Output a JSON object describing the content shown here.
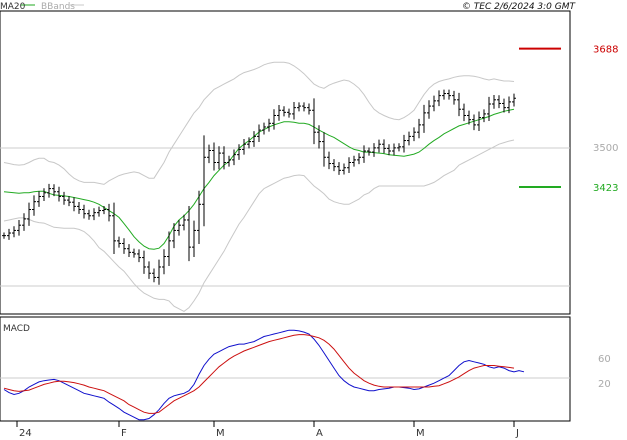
{
  "header": {
    "ma_label": "MA20",
    "bb_label": "BBands",
    "credit": "© TEC 2/6/2024 3:0 GMT"
  },
  "colors": {
    "ma": "#22aa22",
    "bbands": "#c8c8c8",
    "bars": "#000000",
    "macd_line": "#1010cc",
    "signal_line": "#cc1010",
    "resistance": "#cc0000",
    "support": "#22aa22",
    "grid": "#cccccc",
    "border": "#000000"
  },
  "chart_data": [
    {
      "type": "ohlc",
      "title": "",
      "price_axis": {
        "ticks": [
          {
            "value": 3500,
            "label": "3500"
          }
        ],
        "range": [
          3180,
          3760
        ]
      },
      "x_axis": {
        "month_labels": [
          {
            "index": 0,
            "label": "24"
          },
          {
            "index": 23,
            "label": "F"
          },
          {
            "index": 42,
            "label": "M"
          },
          {
            "index": 62,
            "label": "A"
          },
          {
            "index": 82,
            "label": "M"
          },
          {
            "index": 102,
            "label": "J"
          }
        ],
        "count": 103
      },
      "levels": [
        {
          "name": "resistance",
          "value": 3688,
          "label": "3688"
        },
        {
          "name": "support",
          "value": 3423,
          "label": "3423"
        }
      ],
      "closes": [
        3330,
        3335,
        3340,
        3350,
        3362,
        3380,
        3395,
        3405,
        3412,
        3420,
        3414,
        3405,
        3398,
        3394,
        3386,
        3380,
        3372,
        3368,
        3374,
        3378,
        3380,
        3368,
        3320,
        3315,
        3305,
        3298,
        3295,
        3288,
        3270,
        3258,
        3250,
        3270,
        3290,
        3320,
        3340,
        3350,
        3360,
        3308,
        3340,
        3390,
        3480,
        3493,
        3470,
        3488,
        3470,
        3475,
        3485,
        3495,
        3505,
        3510,
        3520,
        3532,
        3538,
        3545,
        3560,
        3570,
        3566,
        3563,
        3575,
        3578,
        3575,
        3570,
        3528,
        3510,
        3480,
        3468,
        3462,
        3455,
        3460,
        3470,
        3475,
        3480,
        3492,
        3490,
        3498,
        3505,
        3497,
        3492,
        3498,
        3500,
        3512,
        3520,
        3528,
        3542,
        3565,
        3578,
        3588,
        3598,
        3602,
        3598,
        3590,
        3572,
        3560,
        3552,
        3542,
        3556,
        3563,
        3582,
        3590,
        3583,
        3575,
        3586,
        3593
      ],
      "ma20": [
        3414,
        3413,
        3412,
        3411,
        3412,
        3412,
        3414,
        3415,
        3415,
        3411,
        3408,
        3407,
        3406,
        3405,
        3403,
        3401,
        3399,
        3397,
        3394,
        3390,
        3384,
        3378,
        3372,
        3365,
        3353,
        3341,
        3328,
        3318,
        3310,
        3305,
        3304,
        3306,
        3315,
        3330,
        3348,
        3360,
        3368,
        3378,
        3390,
        3405,
        3420,
        3432,
        3445,
        3455,
        3465,
        3472,
        3485,
        3497,
        3505,
        3512,
        3520,
        3528,
        3533,
        3538,
        3542,
        3545,
        3548,
        3548,
        3547,
        3545,
        3545,
        3543,
        3538,
        3532,
        3527,
        3522,
        3518,
        3512,
        3506,
        3500,
        3495,
        3493,
        3490,
        3490,
        3489,
        3488,
        3487,
        3485,
        3484,
        3483,
        3482,
        3484,
        3486,
        3490,
        3497,
        3505,
        3512,
        3518,
        3525,
        3530,
        3535,
        3540,
        3543,
        3546,
        3549,
        3552,
        3555,
        3558,
        3562,
        3565,
        3568,
        3570,
        3572
      ],
      "bb_upper": [
        3470,
        3468,
        3466,
        3465,
        3466,
        3470,
        3475,
        3478,
        3478,
        3472,
        3470,
        3465,
        3458,
        3448,
        3440,
        3435,
        3432,
        3432,
        3432,
        3430,
        3428,
        3435,
        3440,
        3445,
        3448,
        3450,
        3452,
        3450,
        3445,
        3440,
        3440,
        3455,
        3470,
        3490,
        3505,
        3520,
        3535,
        3550,
        3565,
        3575,
        3590,
        3600,
        3610,
        3615,
        3620,
        3625,
        3630,
        3637,
        3642,
        3645,
        3648,
        3652,
        3657,
        3660,
        3662,
        3662,
        3662,
        3660,
        3655,
        3648,
        3640,
        3630,
        3620,
        3615,
        3612,
        3618,
        3622,
        3625,
        3628,
        3626,
        3620,
        3612,
        3600,
        3585,
        3572,
        3565,
        3560,
        3556,
        3553,
        3552,
        3556,
        3562,
        3570,
        3585,
        3600,
        3612,
        3620,
        3625,
        3628,
        3630,
        3633,
        3635,
        3636,
        3636,
        3635,
        3633,
        3630,
        3628,
        3630,
        3628,
        3626,
        3626,
        3625
      ],
      "bb_lower": [
        3358,
        3360,
        3362,
        3364,
        3364,
        3361,
        3357,
        3355,
        3354,
        3350,
        3346,
        3345,
        3344,
        3344,
        3344,
        3342,
        3338,
        3330,
        3320,
        3307,
        3300,
        3290,
        3280,
        3270,
        3262,
        3250,
        3238,
        3228,
        3220,
        3215,
        3210,
        3208,
        3208,
        3205,
        3195,
        3190,
        3185,
        3192,
        3205,
        3220,
        3240,
        3255,
        3270,
        3285,
        3300,
        3318,
        3335,
        3352,
        3365,
        3380,
        3395,
        3410,
        3420,
        3425,
        3430,
        3435,
        3440,
        3442,
        3445,
        3446,
        3445,
        3435,
        3425,
        3418,
        3410,
        3400,
        3395,
        3392,
        3390,
        3390,
        3395,
        3400,
        3408,
        3412,
        3420,
        3425,
        3425,
        3425,
        3425,
        3425,
        3425,
        3425,
        3425,
        3425,
        3425,
        3428,
        3432,
        3438,
        3445,
        3450,
        3455,
        3465,
        3470,
        3475,
        3480,
        3485,
        3490,
        3495,
        3500,
        3505,
        3508,
        3511,
        3513
      ]
    },
    {
      "type": "macd",
      "title": "MACD",
      "axis": {
        "ticks": [
          {
            "value": 60,
            "label": "60"
          },
          {
            "value": 20,
            "label": "20"
          }
        ],
        "range": [
          -40,
          125
        ],
        "gridline": 0
      },
      "macd": [
        10,
        5,
        2,
        4,
        8,
        14,
        18,
        22,
        24,
        25,
        26,
        24,
        20,
        16,
        12,
        8,
        4,
        2,
        0,
        -2,
        -4,
        -10,
        -15,
        -20,
        -26,
        -30,
        -34,
        -38,
        -38,
        -36,
        -30,
        -22,
        -12,
        -4,
        0,
        2,
        4,
        8,
        18,
        34,
        48,
        58,
        66,
        70,
        74,
        78,
        80,
        82,
        82,
        84,
        86,
        90,
        94,
        96,
        98,
        100,
        102,
        104,
        104,
        103,
        101,
        98,
        90,
        80,
        68,
        56,
        44,
        32,
        24,
        18,
        14,
        12,
        10,
        8,
        8,
        10,
        11,
        12,
        14,
        14,
        13,
        12,
        10,
        11,
        14,
        17,
        20,
        24,
        28,
        32,
        40,
        48,
        54,
        56,
        54,
        52,
        50,
        46,
        44,
        46,
        44,
        40,
        38,
        40,
        38
      ],
      "signal": [
        12,
        10,
        8,
        7,
        8,
        9,
        12,
        15,
        18,
        20,
        22,
        23,
        23,
        22,
        21,
        19,
        17,
        14,
        12,
        10,
        8,
        4,
        0,
        -4,
        -8,
        -14,
        -18,
        -22,
        -26,
        -28,
        -28,
        -26,
        -20,
        -14,
        -8,
        -4,
        0,
        4,
        8,
        14,
        22,
        30,
        38,
        46,
        52,
        58,
        63,
        67,
        71,
        74,
        77,
        80,
        83,
        86,
        88,
        90,
        92,
        94,
        96,
        97,
        97,
        96,
        94,
        92,
        88,
        82,
        74,
        64,
        54,
        44,
        36,
        30,
        24,
        20,
        17,
        15,
        14,
        14,
        14,
        14,
        14,
        14,
        14,
        14,
        14,
        14,
        15,
        16,
        19,
        22,
        26,
        30,
        35,
        40,
        44,
        46,
        48,
        48,
        48,
        47,
        46,
        45,
        44
      ]
    }
  ]
}
